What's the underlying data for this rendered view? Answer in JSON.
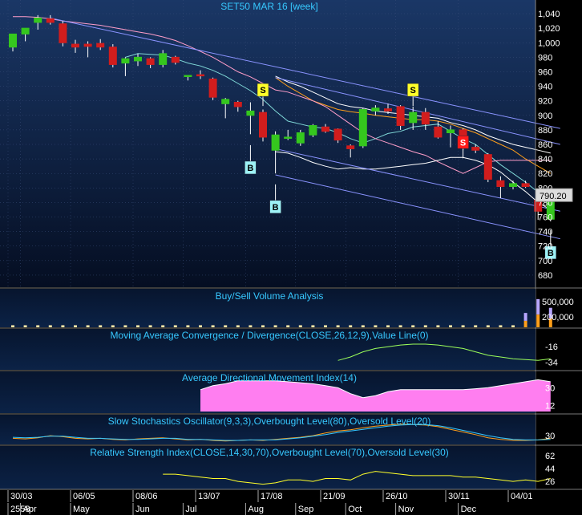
{
  "colors": {
    "bg_top": "#1a3766",
    "bg_bottom": "#050e22",
    "grid": "#3a4f7a",
    "up": "#35c71e",
    "down": "#d11d1d",
    "wick": "#ffffff",
    "channel": "#8a93ff",
    "ma_short": "#7fd7d6",
    "ma_mid": "#ff9f1a",
    "ma_long": "#ffffff",
    "ma_vlong": "#ff9ec9",
    "signal_buy": "#9df2f6",
    "signal_sell": "#ffff2a",
    "signal_sell_alt": "#ff1a1a",
    "title": "#37c8ff",
    "price_label": "#ffffff"
  },
  "chart_data": [
    {
      "type": "candlestick",
      "title": "SET50 MAR 16  [week]",
      "ylim": [
        670,
        1050
      ],
      "yticks": [
        "1,040",
        "1,020",
        "1,000",
        "980",
        "960",
        "940",
        "920",
        "900",
        "880",
        "860",
        "840",
        "820",
        "800",
        "780",
        "760",
        "740",
        "720",
        "700",
        "680"
      ],
      "ytick_values": [
        1040,
        1020,
        1000,
        980,
        960,
        940,
        920,
        900,
        880,
        860,
        840,
        820,
        800,
        780,
        760,
        740,
        720,
        700,
        680
      ],
      "last_price": "790.20",
      "last_price_value": 790.2,
      "candles": [
        {
          "o": 994,
          "h": 1010,
          "l": 988,
          "c": 1012
        },
        {
          "o": 1012,
          "h": 1018,
          "l": 1002,
          "c": 1020
        },
        {
          "o": 1028,
          "h": 1038,
          "l": 1018,
          "c": 1034
        },
        {
          "o": 1033,
          "h": 1038,
          "l": 1025,
          "c": 1028
        },
        {
          "o": 1026,
          "h": 1030,
          "l": 995,
          "c": 1000
        },
        {
          "o": 998,
          "h": 1004,
          "l": 986,
          "c": 994
        },
        {
          "o": 998,
          "h": 1002,
          "l": 980,
          "c": 995
        },
        {
          "o": 999,
          "h": 1005,
          "l": 990,
          "c": 994
        },
        {
          "o": 994,
          "h": 998,
          "l": 966,
          "c": 970
        },
        {
          "o": 972,
          "h": 980,
          "l": 954,
          "c": 978
        },
        {
          "o": 975,
          "h": 985,
          "l": 968,
          "c": 980
        },
        {
          "o": 978,
          "h": 980,
          "l": 965,
          "c": 970
        },
        {
          "o": 970,
          "h": 990,
          "l": 966,
          "c": 985
        },
        {
          "o": 980,
          "h": 982,
          "l": 970,
          "c": 973
        },
        {
          "o": 954,
          "h": 955,
          "l": 948,
          "c": 955
        },
        {
          "o": 956,
          "h": 962,
          "l": 950,
          "c": 955
        },
        {
          "o": 950,
          "h": 952,
          "l": 921,
          "c": 925
        },
        {
          "o": 916,
          "h": 924,
          "l": 896,
          "c": 922
        },
        {
          "o": 918,
          "h": 920,
          "l": 905,
          "c": 912
        },
        {
          "o": 900,
          "h": 918,
          "l": 874,
          "c": 906
        },
        {
          "o": 904,
          "h": 908,
          "l": 864,
          "c": 870
        },
        {
          "o": 852,
          "h": 878,
          "l": 820,
          "c": 873
        },
        {
          "o": 870,
          "h": 880,
          "l": 866,
          "c": 870
        },
        {
          "o": 862,
          "h": 880,
          "l": 858,
          "c": 876
        },
        {
          "o": 873,
          "h": 888,
          "l": 870,
          "c": 886
        },
        {
          "o": 884,
          "h": 888,
          "l": 876,
          "c": 878
        },
        {
          "o": 881,
          "h": 882,
          "l": 862,
          "c": 866
        },
        {
          "o": 858,
          "h": 860,
          "l": 842,
          "c": 854
        },
        {
          "o": 858,
          "h": 910,
          "l": 855,
          "c": 908
        },
        {
          "o": 906,
          "h": 914,
          "l": 900,
          "c": 910
        },
        {
          "o": 909,
          "h": 916,
          "l": 902,
          "c": 906
        },
        {
          "o": 912,
          "h": 914,
          "l": 880,
          "c": 886
        },
        {
          "o": 890,
          "h": 912,
          "l": 880,
          "c": 904
        },
        {
          "o": 904,
          "h": 910,
          "l": 880,
          "c": 888
        },
        {
          "o": 884,
          "h": 892,
          "l": 868,
          "c": 870
        },
        {
          "o": 876,
          "h": 886,
          "l": 856,
          "c": 880
        },
        {
          "o": 880,
          "h": 882,
          "l": 852,
          "c": 860
        },
        {
          "o": 856,
          "h": 860,
          "l": 848,
          "c": 852
        },
        {
          "o": 846,
          "h": 848,
          "l": 808,
          "c": 812
        },
        {
          "o": 810,
          "h": 816,
          "l": 786,
          "c": 802
        },
        {
          "o": 802,
          "h": 810,
          "l": 798,
          "c": 806
        },
        {
          "o": 806,
          "h": 810,
          "l": 800,
          "c": 802
        },
        {
          "o": 783,
          "h": 790,
          "l": 756,
          "c": 768
        },
        {
          "o": 757,
          "h": 800,
          "l": 754,
          "c": 790
        }
      ],
      "moving_averages": [
        {
          "color": "ma_short",
          "values": [
            null,
            null,
            null,
            null,
            null,
            null,
            null,
            null,
            null,
            980,
            985,
            984,
            983,
            978,
            972,
            968,
            962,
            954,
            944,
            934,
            922,
            906,
            892,
            888,
            884,
            882,
            876,
            868,
            862,
            868,
            875,
            878,
            884,
            886,
            888,
            878,
            868,
            860,
            846,
            832,
            820,
            808,
            794,
            786
          ]
        },
        {
          "color": "ma_mid",
          "values": [
            null,
            null,
            null,
            null,
            null,
            null,
            null,
            null,
            null,
            null,
            null,
            null,
            null,
            null,
            null,
            null,
            null,
            null,
            null,
            null,
            null,
            952,
            940,
            930,
            920,
            914,
            908,
            905,
            903,
            900,
            898,
            896,
            894,
            894,
            892,
            888,
            882,
            876,
            868,
            860,
            852,
            840,
            830,
            820
          ]
        },
        {
          "color": "ma_long",
          "values": [
            null,
            null,
            null,
            null,
            null,
            null,
            null,
            null,
            null,
            null,
            null,
            null,
            null,
            null,
            null,
            null,
            null,
            null,
            null,
            null,
            null,
            954,
            946,
            940,
            932,
            924,
            916,
            912,
            910,
            906,
            904,
            902,
            900,
            898,
            896,
            890,
            886,
            880,
            872,
            866,
            860,
            856,
            852,
            848
          ]
        },
        {
          "color": "ma_vlong",
          "values": [
            1036,
            1036,
            1035,
            1033,
            1030,
            1028,
            1026,
            1024,
            1021,
            1018,
            1015,
            1012,
            1008,
            1003,
            996,
            988,
            980,
            970,
            960,
            953,
            944,
            935,
            932,
            926,
            920,
            912,
            900,
            888,
            876,
            868,
            862,
            856,
            850,
            845,
            836,
            828,
            820,
            828,
            836,
            838,
            838,
            838,
            838,
            838
          ]
        }
      ],
      "bollinger": {
        "upper": null,
        "lower_values": [
          null,
          null,
          null,
          null,
          null,
          null,
          null,
          null,
          null,
          null,
          null,
          null,
          null,
          null,
          null,
          null,
          null,
          null,
          null,
          null,
          null,
          850,
          848,
          842,
          835,
          830,
          826,
          828,
          826,
          826,
          828,
          830,
          832,
          834,
          838,
          842,
          842,
          838,
          832,
          822,
          808,
          795,
          780,
          770
        ]
      },
      "channel_upper": {
        "x0": 3,
        "y0": 1034,
        "x1": 43,
        "y1": 882
      },
      "channel_upper2": {
        "x0": 21,
        "y0": 952,
        "x1": 43,
        "y1": 860
      },
      "channel_lower": {
        "x0": 21,
        "y0": 854,
        "x1": 43,
        "y1": 768
      },
      "channel_lower2": {
        "x0": 21,
        "y0": 818,
        "x1": 43,
        "y1": 730
      },
      "signals": [
        {
          "label": "S",
          "type": "sell",
          "candle": 20,
          "price": 935
        },
        {
          "label": "B",
          "type": "buy",
          "candle": 19,
          "price": 828
        },
        {
          "label": "B",
          "type": "buy",
          "candle": 21,
          "price": 774
        },
        {
          "label": "S",
          "type": "sell",
          "candle": 32,
          "price": 935
        },
        {
          "label": "S",
          "type": "sell_alt",
          "candle": 36,
          "price": 863
        },
        {
          "label": "B",
          "type": "buy",
          "candle": 43,
          "price": 711
        }
      ]
    },
    {
      "type": "bar",
      "title": "Buy/Sell Volume Analysis",
      "yticks": [
        "500,000",
        "200,000"
      ],
      "ytick_values": [
        500000,
        200000
      ],
      "ylim": [
        0,
        720000
      ],
      "values": [
        40000,
        40000,
        40000,
        40000,
        40000,
        40000,
        40000,
        40000,
        40000,
        40000,
        40000,
        40000,
        40000,
        40000,
        40000,
        40000,
        40000,
        40000,
        40000,
        40000,
        40000,
        40000,
        40000,
        40000,
        40000,
        40000,
        40000,
        40000,
        40000,
        40000,
        40000,
        40000,
        40000,
        40000,
        40000,
        40000,
        40000,
        40000,
        40000,
        40000,
        40000,
        280000,
        550000,
        380000
      ]
    },
    {
      "type": "line",
      "title": "Moving Average Convergence / Divergence(CLOSE,26,12,9),Value Line(0)",
      "yticks": [
        "-16",
        "-34"
      ],
      "ytick_values": [
        -16,
        -34
      ],
      "ylim": [
        -42,
        2
      ],
      "series": [
        {
          "values": [
            null,
            null,
            null,
            null,
            null,
            null,
            null,
            null,
            null,
            null,
            null,
            null,
            null,
            null,
            null,
            null,
            null,
            null,
            null,
            null,
            null,
            null,
            null,
            null,
            null,
            null,
            -32,
            -28,
            -22,
            -18,
            -16,
            -14,
            -13,
            -13,
            -14,
            -16,
            -18,
            -22,
            -26,
            -28,
            -30,
            -31,
            -32,
            -30
          ]
        }
      ]
    },
    {
      "type": "area",
      "title": "Average Directional Movement Index(14)",
      "yticks": [
        "30",
        "12"
      ],
      "ytick_values": [
        30,
        12
      ],
      "ylim": [
        6,
        44
      ],
      "series": [
        {
          "values": [
            null,
            null,
            null,
            null,
            null,
            null,
            null,
            null,
            null,
            null,
            null,
            null,
            null,
            null,
            null,
            28,
            32,
            34,
            37,
            37,
            37,
            37,
            36,
            35,
            34,
            32,
            30,
            24,
            20,
            22,
            26,
            28,
            28,
            28,
            28,
            28,
            28,
            29,
            30,
            32,
            34,
            36,
            38,
            36
          ]
        }
      ]
    },
    {
      "type": "line",
      "title": "Slow Stochastics Oscillator(9,3,3),Overbought Level(80),Oversold Level(20)",
      "yticks": [
        "30"
      ],
      "ytick_values": [
        30
      ],
      "ylim": [
        0,
        100
      ],
      "series": [
        {
          "values": [
            20,
            18,
            22,
            30,
            26,
            20,
            18,
            20,
            16,
            14,
            18,
            20,
            22,
            18,
            14,
            16,
            12,
            10,
            12,
            14,
            12,
            16,
            20,
            24,
            30,
            40,
            48,
            52,
            60,
            66,
            70,
            74,
            72,
            70,
            64,
            54,
            44,
            34,
            22,
            16,
            12,
            12,
            14,
            20
          ]
        },
        {
          "values": [
            24,
            22,
            24,
            28,
            28,
            24,
            20,
            20,
            18,
            16,
            16,
            18,
            20,
            20,
            16,
            16,
            14,
            12,
            12,
            14,
            14,
            14,
            18,
            22,
            28,
            34,
            42,
            48,
            54,
            60,
            66,
            70,
            72,
            72,
            68,
            60,
            50,
            40,
            30,
            22,
            16,
            14,
            14,
            16
          ]
        }
      ]
    },
    {
      "type": "line",
      "title": "Relative Strength Index(CLOSE,14,30,70),Overbought Level(70),Oversold Level(30)",
      "yticks": [
        "62",
        "44",
        "26"
      ],
      "ytick_values": [
        62,
        44,
        26
      ],
      "ylim": [
        16,
        72
      ],
      "series": [
        {
          "values": [
            null,
            null,
            null,
            null,
            null,
            null,
            null,
            null,
            null,
            null,
            null,
            null,
            36,
            36,
            34,
            32,
            30,
            30,
            26,
            24,
            22,
            24,
            28,
            28,
            26,
            30,
            30,
            28,
            36,
            40,
            38,
            36,
            34,
            34,
            34,
            34,
            32,
            32,
            30,
            28,
            26,
            28,
            26,
            30
          ]
        }
      ]
    }
  ],
  "xaxis": {
    "date_ticks": [
      {
        "label": "30/03",
        "candle": 0
      },
      {
        "label": "06/05",
        "candle": 5
      },
      {
        "label": "08/06",
        "candle": 10
      },
      {
        "label": "13/07",
        "candle": 15
      },
      {
        "label": "17/08",
        "candle": 20
      },
      {
        "label": "21/09",
        "candle": 25
      },
      {
        "label": "26/10",
        "candle": 30
      },
      {
        "label": "30/11",
        "candle": 35
      },
      {
        "label": "04/01",
        "candle": 40
      }
    ],
    "month_ticks": [
      {
        "label": "2558",
        "candle": 0
      },
      {
        "label": "Apr",
        "candle": 1
      },
      {
        "label": "May",
        "candle": 5
      },
      {
        "label": "Jun",
        "candle": 10
      },
      {
        "label": "Jul",
        "candle": 14
      },
      {
        "label": "Aug",
        "candle": 19
      },
      {
        "label": "Sep",
        "candle": 23
      },
      {
        "label": "Oct",
        "candle": 27
      },
      {
        "label": "Nov",
        "candle": 31
      },
      {
        "label": "Dec",
        "candle": 36
      }
    ]
  }
}
